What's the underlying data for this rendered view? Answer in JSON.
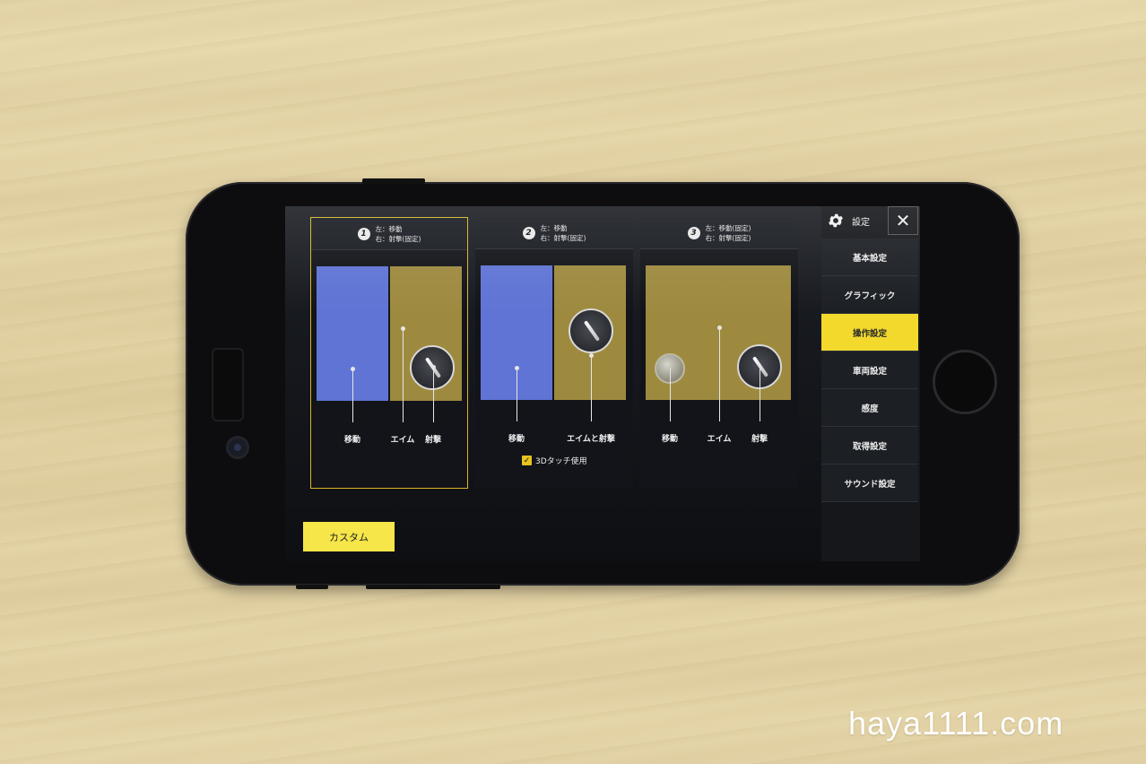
{
  "settings": {
    "title": "設定",
    "close_icon": "close-icon",
    "gear_icon": "gear-icon",
    "menu": [
      {
        "label": "基本設定",
        "active": false
      },
      {
        "label": "グラフィック",
        "active": false
      },
      {
        "label": "操作設定",
        "active": true
      },
      {
        "label": "車両設定",
        "active": false
      },
      {
        "label": "感度",
        "active": false
      },
      {
        "label": "取得設定",
        "active": false
      },
      {
        "label": "サウンド設定",
        "active": false
      }
    ]
  },
  "modes": [
    {
      "number": "1",
      "line1": "左：移動",
      "line2": "右：射撃(固定)",
      "selected": true,
      "labels": {
        "move": "移動",
        "aim": "エイム",
        "shoot": "射撃"
      }
    },
    {
      "number": "2",
      "line1": "左：移動",
      "line2": "右：射撃(固定)",
      "selected": false,
      "labels": {
        "move": "移動",
        "aim_shoot": "エイムと射撃"
      }
    },
    {
      "number": "3",
      "line1": "左：移動(固定)",
      "line2": "右：射撃(固定)",
      "selected": false,
      "labels": {
        "move": "移動",
        "aim": "エイム",
        "shoot": "射撃"
      }
    }
  ],
  "touch3d": {
    "label": "3Dタッチ使用",
    "checked": true
  },
  "custom_button": "カスタム",
  "watermark": "haya1111.com",
  "colors": {
    "accent": "#f2d92c",
    "move_zone": "#5f74d4",
    "aim_zone": "#9e8a3f"
  }
}
